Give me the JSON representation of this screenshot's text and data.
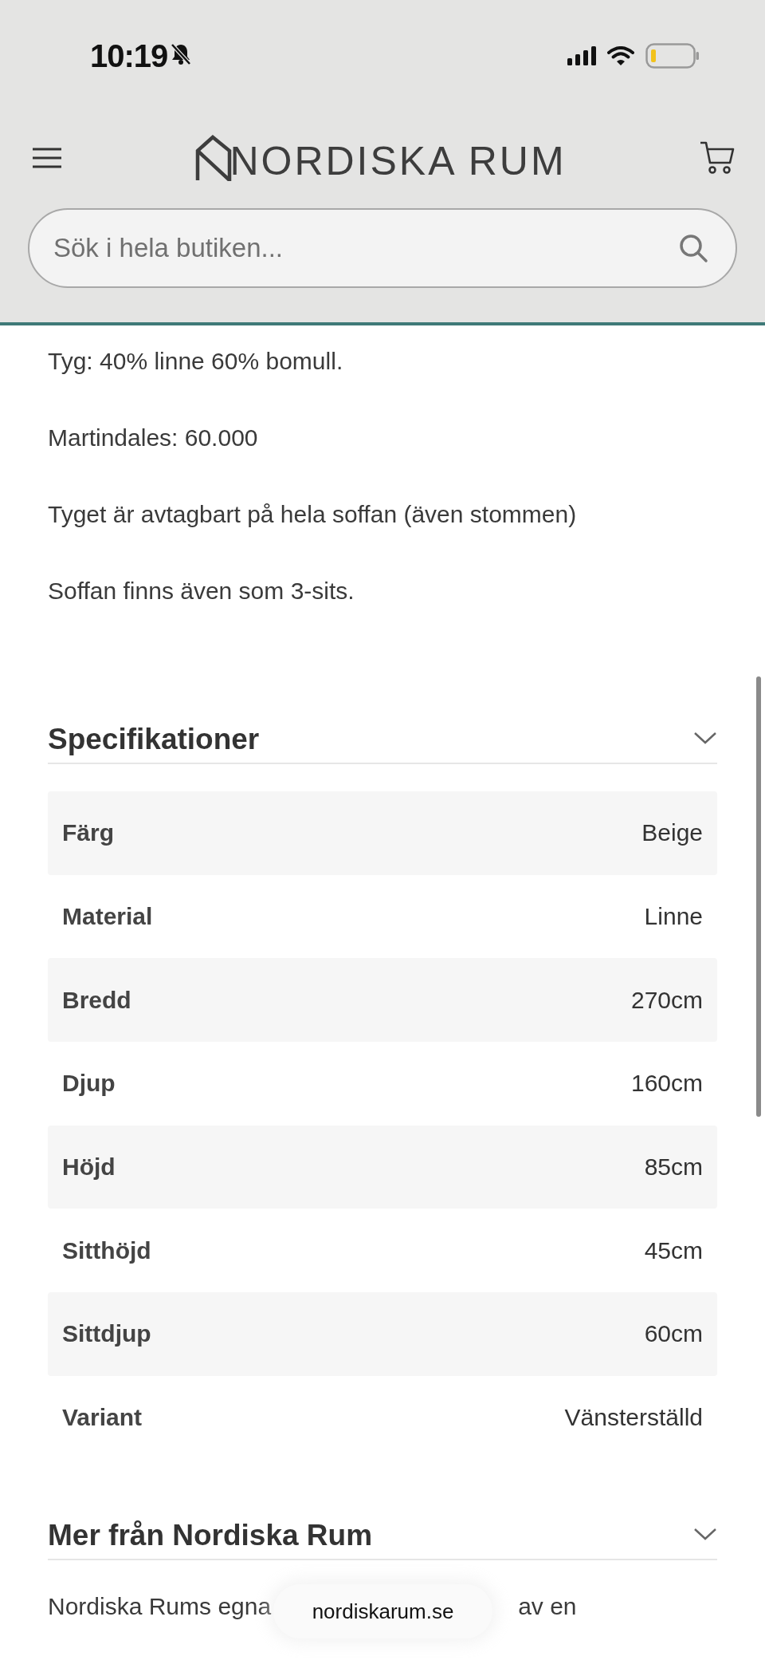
{
  "status_bar": {
    "time": "10:19"
  },
  "header": {
    "logo": "NORDISKA RUM",
    "search": {
      "placeholder": "Sök i hela butiken..."
    }
  },
  "description": [
    "Tyg: 40% linne 60% bomull.",
    "Martindales: 60.000",
    "Tyget är avtagbart  på hela soffan (även stommen)",
    "Soffan finns även som 3-sits."
  ],
  "specifications": {
    "title": "Specifikationer",
    "expanded": true,
    "rows": [
      {
        "label": "Färg",
        "value": "Beige"
      },
      {
        "label": "Material",
        "value": "Linne"
      },
      {
        "label": "Bredd",
        "value": "270cm"
      },
      {
        "label": "Djup",
        "value": "160cm"
      },
      {
        "label": "Höjd",
        "value": "85cm"
      },
      {
        "label": "Sitthöjd",
        "value": "45cm"
      },
      {
        "label": "Sittdjup",
        "value": "60cm"
      },
      {
        "label": "Variant",
        "value": "Vänsterställd"
      }
    ]
  },
  "more": {
    "title": "Mer från Nordiska Rum",
    "text_parts": [
      "Nordiska Rums egna",
      "av en"
    ]
  },
  "address_bar": {
    "url": "nordiskarum.se"
  }
}
